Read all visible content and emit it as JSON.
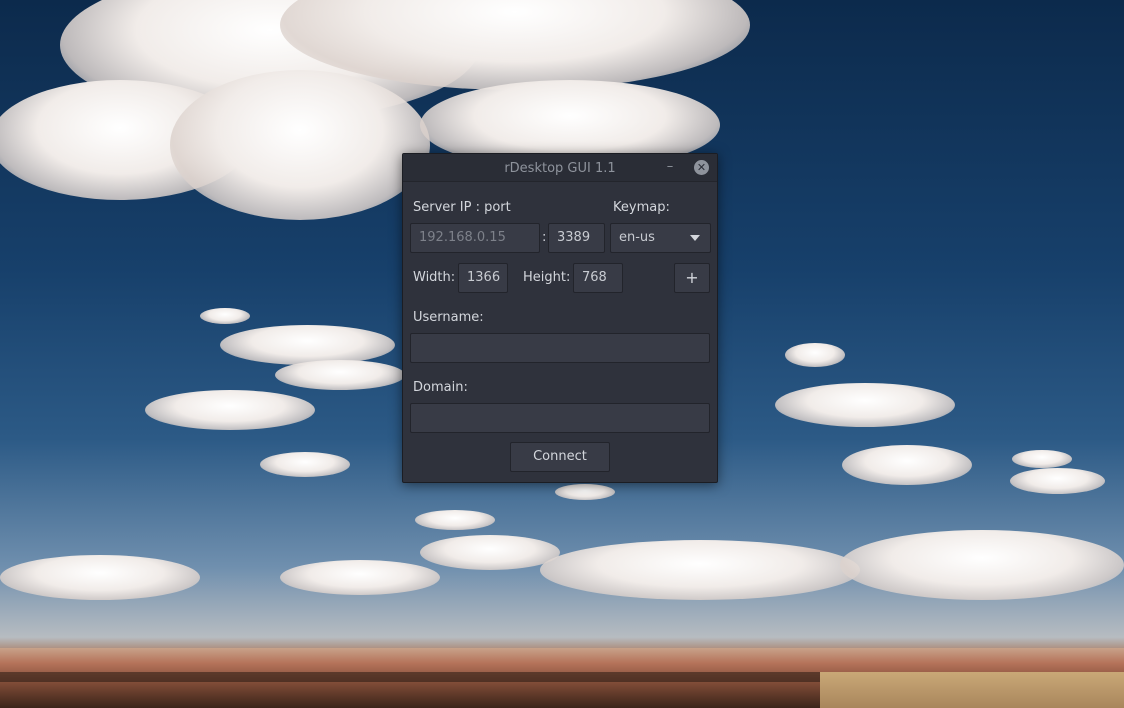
{
  "window": {
    "title": "rDesktop GUI 1.1",
    "minimize_glyph": "–",
    "close_glyph": "✕"
  },
  "form": {
    "server_label": "Server IP : port",
    "server_ip_placeholder": "192.168.0.15",
    "port_separator": ":",
    "port_value": "3389",
    "keymap_label": "Keymap:",
    "keymap_value": "en-us",
    "width_label": "Width:",
    "width_value": "1366",
    "height_label": "Height:",
    "height_value": "768",
    "add_glyph": "+",
    "username_label": "Username:",
    "username_value": "",
    "domain_label": "Domain:",
    "domain_value": "",
    "connect_label": "Connect"
  },
  "icons": {
    "minimize": "minimize-icon",
    "close": "close-icon",
    "dropdown": "chevron-down-icon",
    "add": "plus-icon"
  },
  "colors": {
    "window_bg": "#2f323c",
    "field_bg": "#383b46",
    "text": "#d3d6dc",
    "placeholder": "#7d818a"
  }
}
